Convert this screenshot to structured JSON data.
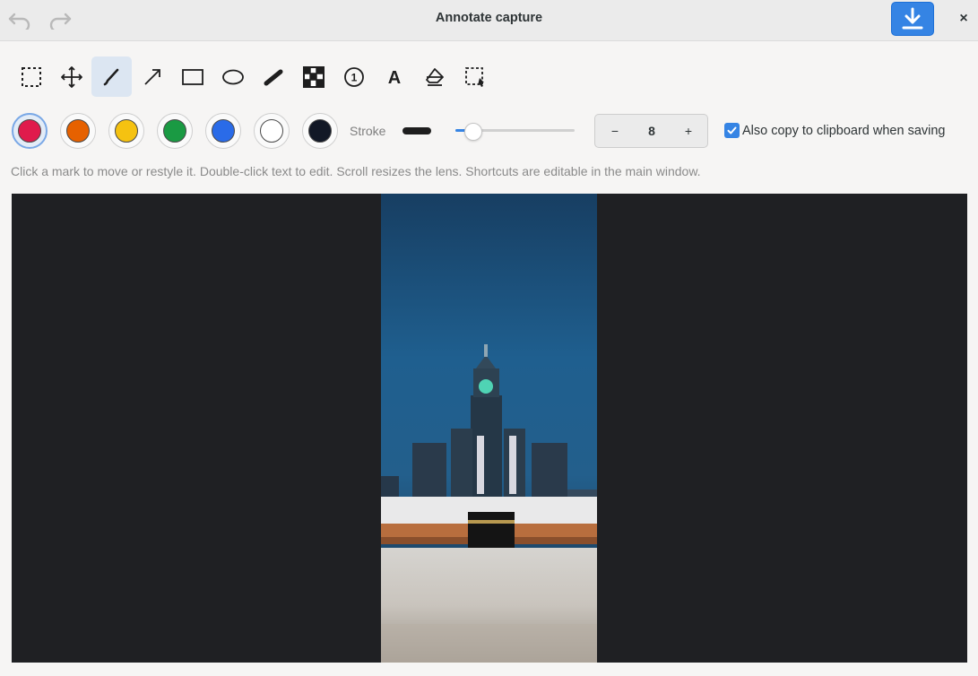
{
  "header": {
    "title": "Annotate capture",
    "undo_icon": "undo-icon",
    "redo_icon": "redo-icon",
    "save_icon": "download-icon",
    "close_label": "×",
    "accent": "#3584e4"
  },
  "tools": [
    {
      "name": "select",
      "icon": "selection-icon"
    },
    {
      "name": "move",
      "icon": "move-icon"
    },
    {
      "name": "pen",
      "icon": "pen-icon",
      "active": true
    },
    {
      "name": "arrow",
      "icon": "arrow-icon"
    },
    {
      "name": "rectangle",
      "icon": "rectangle-icon"
    },
    {
      "name": "ellipse",
      "icon": "ellipse-icon"
    },
    {
      "name": "highlighter",
      "icon": "highlighter-icon"
    },
    {
      "name": "pixelate",
      "icon": "pixelate-icon"
    },
    {
      "name": "counter",
      "icon": "counter-icon",
      "label": "1"
    },
    {
      "name": "text",
      "icon": "text-icon",
      "label": "A"
    },
    {
      "name": "eraser",
      "icon": "eraser-icon"
    },
    {
      "name": "crop",
      "icon": "crop-icon"
    }
  ],
  "colors": [
    {
      "name": "red",
      "hex": "#e01b4c",
      "selected": true
    },
    {
      "name": "orange",
      "hex": "#e66100"
    },
    {
      "name": "yellow",
      "hex": "#f5c211"
    },
    {
      "name": "green",
      "hex": "#1a9a43"
    },
    {
      "name": "blue",
      "hex": "#2a6be8"
    },
    {
      "name": "white",
      "hex": "#ffffff"
    },
    {
      "name": "black",
      "hex": "#121826"
    }
  ],
  "stroke": {
    "label": "Stroke",
    "slider_fraction": 0.15,
    "value": "8",
    "minus_label": "−",
    "plus_label": "+"
  },
  "clipboard": {
    "label": "Also copy to clipboard when saving",
    "checked": true
  },
  "hint": "Click a mark to move or restyle it. Double-click text to edit. Scroll resizes the lens. Shortcuts are editable in the main window."
}
